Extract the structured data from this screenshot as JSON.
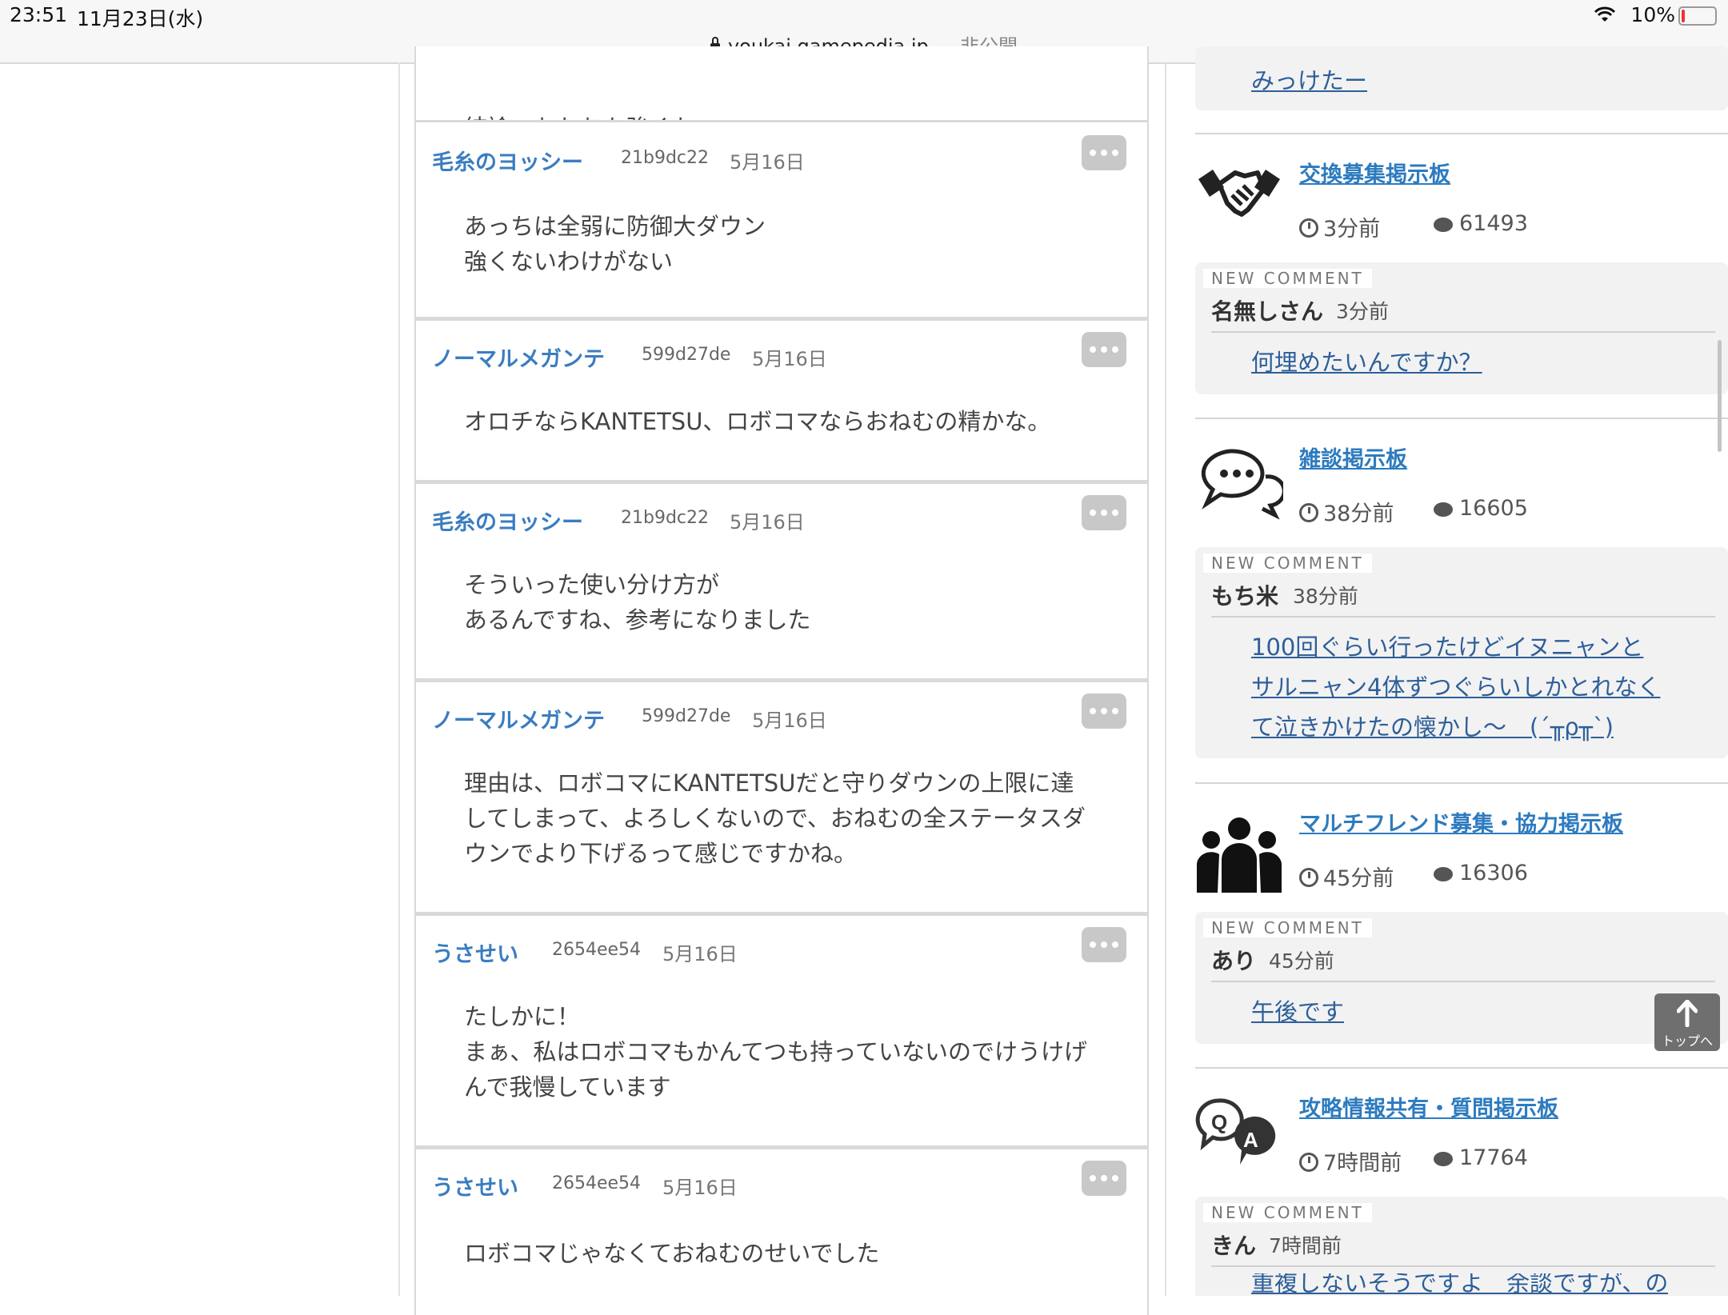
{
  "status_bar": {
    "time": "23:51",
    "date": "11月23日(水)",
    "url": "youkai.gamepedia.jp",
    "url_suffix": " — 非公開",
    "battery": "10%"
  },
  "comments": {
    "top_fragment": "結論、おねむも強くね",
    "items": [
      {
        "name": "毛糸のヨッシー",
        "id": "21b9dc22",
        "date": "5月16日",
        "lines": [
          "あっちは全弱に防御大ダウン",
          "強くないわけがない"
        ]
      },
      {
        "name": "ノーマルメガンテ",
        "id": "599d27de",
        "date": "5月16日",
        "lines": [
          "オロチならKANTETSU、ロボコマならおねむの精かな。"
        ]
      },
      {
        "name": "毛糸のヨッシー",
        "id": "21b9dc22",
        "date": "5月16日",
        "lines": [
          "そういった使い分け方が",
          "あるんですね、参考になりました"
        ]
      },
      {
        "name": "ノーマルメガンテ",
        "id": "599d27de",
        "date": "5月16日",
        "lines": [
          "理由は、ロボコマにKANTETSUだと守りダウンの上限に達",
          "してしまって、よろしくないので、おねむの全ステータスダ",
          "ウンでより下げるって感じですかね。"
        ]
      },
      {
        "name": "うさせい",
        "id": "2654ee54",
        "date": "5月16日",
        "lines": [
          "たしかに！",
          "まぁ、私はロボコマもかんてつも持っていないのでけうけげ",
          "んで我慢しています"
        ]
      },
      {
        "name": "うさせい",
        "id": "2654ee54",
        "date": "5月16日",
        "lines": [
          "ロボコマじゃなくておねむのせいでした"
        ]
      }
    ]
  },
  "sidebar": {
    "top_fragment": "みっけたー",
    "new_comment_label": "NEW COMMENT",
    "boards": [
      {
        "title": "交換募集掲示板",
        "time": "3分前",
        "count": "61493",
        "icon": "handshake-icon",
        "nc": {
          "author": "名無しさん",
          "ago": "3分前",
          "lines": [
            "何埋めたいんですか？"
          ]
        }
      },
      {
        "title": "雑談掲示板",
        "time": "38分前",
        "count": "16605",
        "icon": "chat-bubbles-icon",
        "nc": {
          "author": "もち米",
          "ago": "38分前",
          "lines": [
            "100回ぐらい行ったけどイヌニャンと",
            "サルニャン4体ずつぐらいしかとれなく",
            "て泣きかけたの懐かし〜　(´╥ρ╥`)"
          ]
        }
      },
      {
        "title": "マルチフレンド募集・協力掲示板",
        "time": "45分前",
        "count": "16306",
        "icon": "group-icon",
        "nc": {
          "author": "あり",
          "ago": "45分前",
          "lines": [
            "午後です"
          ]
        }
      },
      {
        "title": "攻略情報共有・質問掲示板",
        "time": "7時間前",
        "count": "17764",
        "icon": "qa-icon",
        "nc": {
          "author": "きん",
          "ago": "7時間前",
          "lines": [
            "重複しないそうですよ　余談ですが、の"
          ]
        }
      }
    ],
    "to_top_label": "トップへ"
  }
}
